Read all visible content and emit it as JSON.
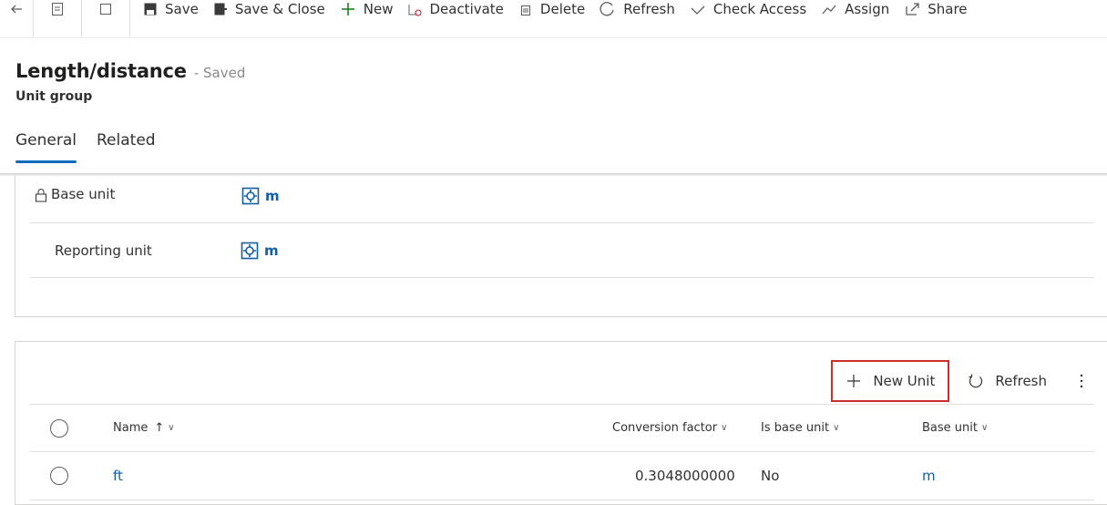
{
  "command_bar": {
    "save": "Save",
    "save_close": "Save & Close",
    "new": "New",
    "deactivate": "Deactivate",
    "delete": "Delete",
    "refresh": "Refresh",
    "check_access": "Check Access",
    "assign": "Assign",
    "share": "Share"
  },
  "header": {
    "title": "Length/distance",
    "status": "- Saved",
    "entity": "Unit group"
  },
  "tabs": [
    "General",
    "Related"
  ],
  "fields": {
    "base_unit": {
      "label": "Base unit",
      "value": "m"
    },
    "reporting_unit": {
      "label": "Reporting unit",
      "value": "m"
    }
  },
  "grid": {
    "toolbar": {
      "new_unit": "New Unit",
      "refresh": "Refresh"
    },
    "columns": {
      "name": "Name",
      "conversion_factor": "Conversion factor",
      "is_base_unit": "Is base unit",
      "base_unit": "Base unit"
    },
    "rows": [
      {
        "name": "ft",
        "conversion_factor": "0.3048000000",
        "is_base_unit": "No",
        "base_unit": "m"
      }
    ]
  },
  "colors": {
    "accent": "#0f6cbd",
    "link": "#115ea3",
    "highlight_border": "#c9302c"
  }
}
